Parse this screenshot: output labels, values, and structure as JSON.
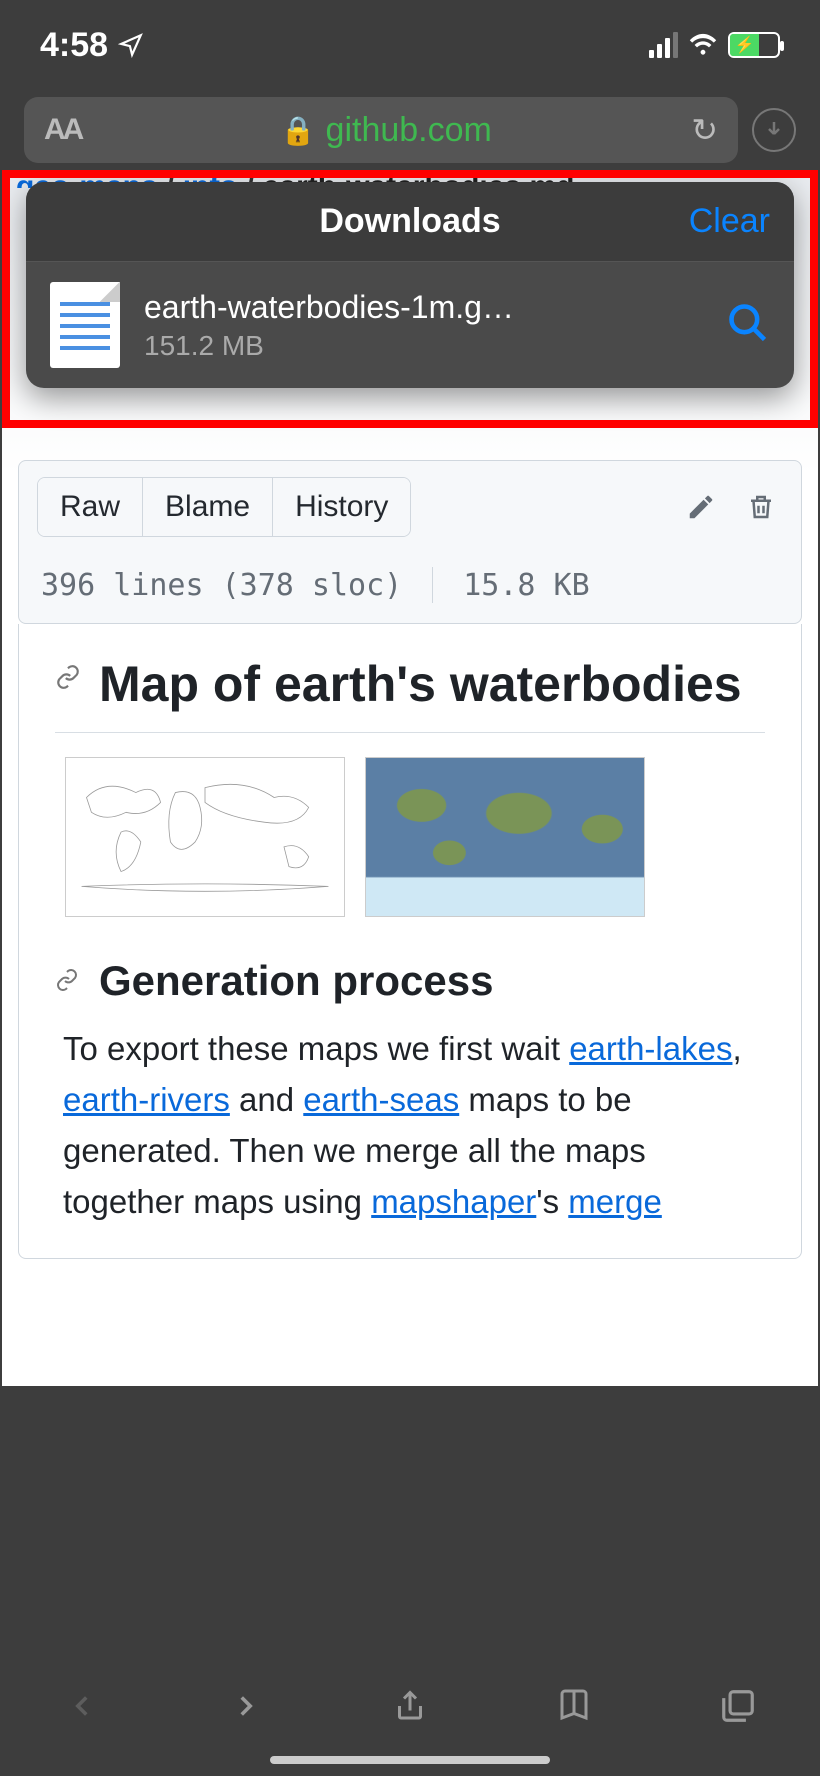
{
  "status": {
    "time": "4:58"
  },
  "urlbar": {
    "aa": "AA",
    "domain": "github.com"
  },
  "breadcrumb": {
    "p1": "geo-maps",
    "p2": "info",
    "p3": "earth-waterbodies.md"
  },
  "downloads": {
    "title": "Downloads",
    "clear": "Clear",
    "item": {
      "filename": "earth-waterbodies-1m.g…",
      "size": "151.2 MB"
    }
  },
  "filebox": {
    "raw": "Raw",
    "blame": "Blame",
    "history": "History",
    "stats_lines": "396 lines (378 sloc)",
    "stats_size": "15.8 KB"
  },
  "readme": {
    "h1": "Map of earth's waterbodies",
    "h2": "Generation process",
    "p_start": "To export these maps we first wait ",
    "link_lakes": "earth-lakes",
    "link_rivers": "earth-rivers",
    "and": " and ",
    "link_seas": "earth-seas",
    "p_mid": " maps to be generated. Then we merge all the maps together maps using ",
    "link_mapshaper": "mapshaper",
    "apos_s": "'s ",
    "link_merge": "merge",
    "comma": ", "
  }
}
